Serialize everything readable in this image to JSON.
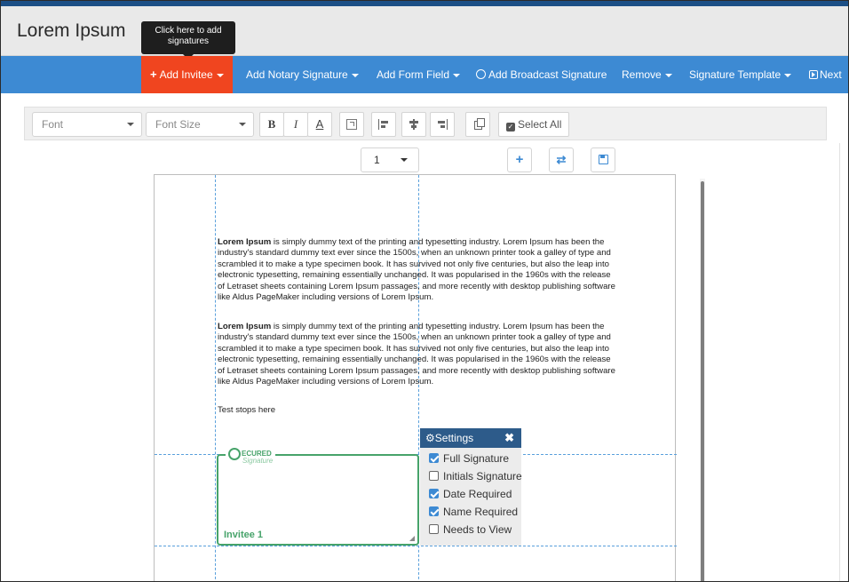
{
  "header": {
    "title": "Lorem Ipsum",
    "tooltip": "Click here to add signatures"
  },
  "navbar": {
    "items": [
      {
        "label": "Add Invitee",
        "prefix": "+"
      },
      {
        "label": "Add Notary Signature"
      },
      {
        "label": "Add Form Field"
      },
      {
        "label": "Add Broadcast Signature"
      },
      {
        "label": "Remove"
      },
      {
        "label": "Signature Template"
      },
      {
        "label": "Next"
      }
    ],
    "accent_active": "#f0451f",
    "bar_color": "#3d8ad3"
  },
  "format_toolbar": {
    "font_placeholder": "Font",
    "font_size_placeholder": "Font Size",
    "bold": "B",
    "italic": "I",
    "underline": "A",
    "select_all": "Select All"
  },
  "page_controls": {
    "page_number": "1"
  },
  "document": {
    "paragraphs": [
      {
        "bold": "Lorem Ipsum",
        "text": " is simply dummy text of the printing and typesetting industry. Lorem Ipsum has been the industry's standard dummy text ever since the 1500s, when an unknown printer took a galley of type and scrambled it to make a type specimen book. It has survived not only five centuries, but also the leap into electronic typesetting, remaining essentially unchanged. It was popularised in the 1960s with the release of Letraset sheets containing Lorem Ipsum passages, and more recently with desktop publishing software like Aldus PageMaker including versions of Lorem Ipsum."
      },
      {
        "bold": "Lorem Ipsum",
        "text": " is simply dummy text of the printing and typesetting industry. Lorem Ipsum has been the industry's standard dummy text ever since the 1500s, when an unknown printer took a galley of type and scrambled it to make a type specimen book. It has survived not only five centuries, but also the leap into electronic typesetting, remaining essentially unchanged. It was popularised in the 1960s with the release of Letraset sheets containing Lorem Ipsum passages, and more recently with desktop publishing software like Aldus PageMaker including versions of Lorem Ipsum."
      }
    ],
    "end_text": "Test stops here"
  },
  "signature_box": {
    "logo_text": "ECURED",
    "logo_script": "Signature",
    "invitee_label": "Invitee 1",
    "border_color": "#47a36a"
  },
  "settings": {
    "title": "Settings",
    "options": [
      {
        "label": "Full Signature",
        "checked": true
      },
      {
        "label": "Initials Signature",
        "checked": false
      },
      {
        "label": "Date Required",
        "checked": true
      },
      {
        "label": "Name Required",
        "checked": true
      },
      {
        "label": "Needs to View",
        "checked": false
      }
    ]
  },
  "icons": {
    "add_page": "plus-icon",
    "swap": "swap-icon",
    "save": "save-icon",
    "settings": "gear-icon",
    "close": "close-icon",
    "next": "next-icon",
    "broadcast": "broadcast-icon"
  }
}
